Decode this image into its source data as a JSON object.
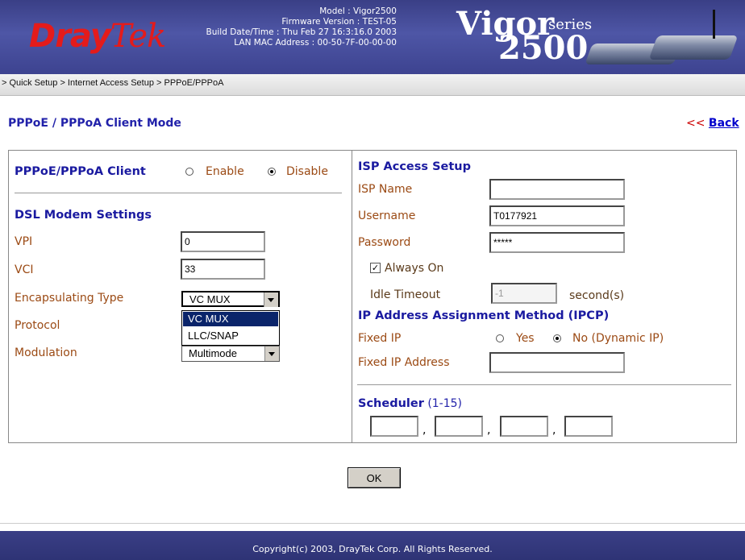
{
  "header": {
    "logo_dray": "Dray",
    "logo_tek": "Tek",
    "model": "Model : Vigor2500",
    "firmware": "Firmware Version : TEST-05",
    "build": "Build Date/Time : Thu Feb 27 16:3:16.0 2003",
    "mac": "LAN MAC Address : 00-50-7F-00-00-00",
    "brand_vigor": "Vigor",
    "brand_series": "series",
    "brand_num": "2500"
  },
  "breadcrumb": "> Quick Setup > Internet Access Setup > PPPoE/PPPoA",
  "title": "PPPoE / PPPoA Client Mode",
  "back": {
    "arrows": "<< ",
    "label": "Back"
  },
  "left": {
    "client_label": "PPPoE/PPPoA Client",
    "enable": "Enable",
    "disable": "Disable",
    "client_state": "Disable",
    "dsl_heading": "DSL Modem Settings",
    "vpi_label": "VPI",
    "vpi_value": "0",
    "vci_label": "VCI",
    "vci_value": "33",
    "encap_label": "Encapsulating Type",
    "encap_value": "VC MUX",
    "encap_options": [
      "VC MUX",
      "LLC/SNAP"
    ],
    "protocol_label": "Protocol",
    "modulation_label": "Modulation",
    "modulation_value": "Multimode"
  },
  "right": {
    "isp_heading": "ISP Access Setup",
    "isp_name_label": "ISP Name",
    "isp_name_value": "",
    "username_label": "Username",
    "username_value": "T0177921",
    "password_label": "Password",
    "password_value": "*****",
    "always_on_label": "Always On",
    "always_on_checked": true,
    "idle_label": "Idle Timeout",
    "idle_value": "-1",
    "idle_unit": "second(s)",
    "ipcp_heading": "IP Address Assignment Method (IPCP)",
    "fixed_ip_label": "Fixed IP",
    "yes": "Yes",
    "no": "No (Dynamic IP)",
    "fixed_ip_state": "No",
    "fixed_addr_label": "Fixed IP Address",
    "fixed_addr_value": "",
    "scheduler_label": "Scheduler",
    "scheduler_range": "(1-15)",
    "scheduler_values": [
      "",
      "",
      "",
      ""
    ],
    "comma": ","
  },
  "ok_label": "OK",
  "footer": "Copyright(c) 2003, DrayTek Corp. All Rights Reserved.",
  "colors": {
    "header_bg": "#3d4390",
    "heading_blue": "#1a1aa0",
    "label_brown": "#9b4a14",
    "logo_red": "#e41b1b"
  }
}
